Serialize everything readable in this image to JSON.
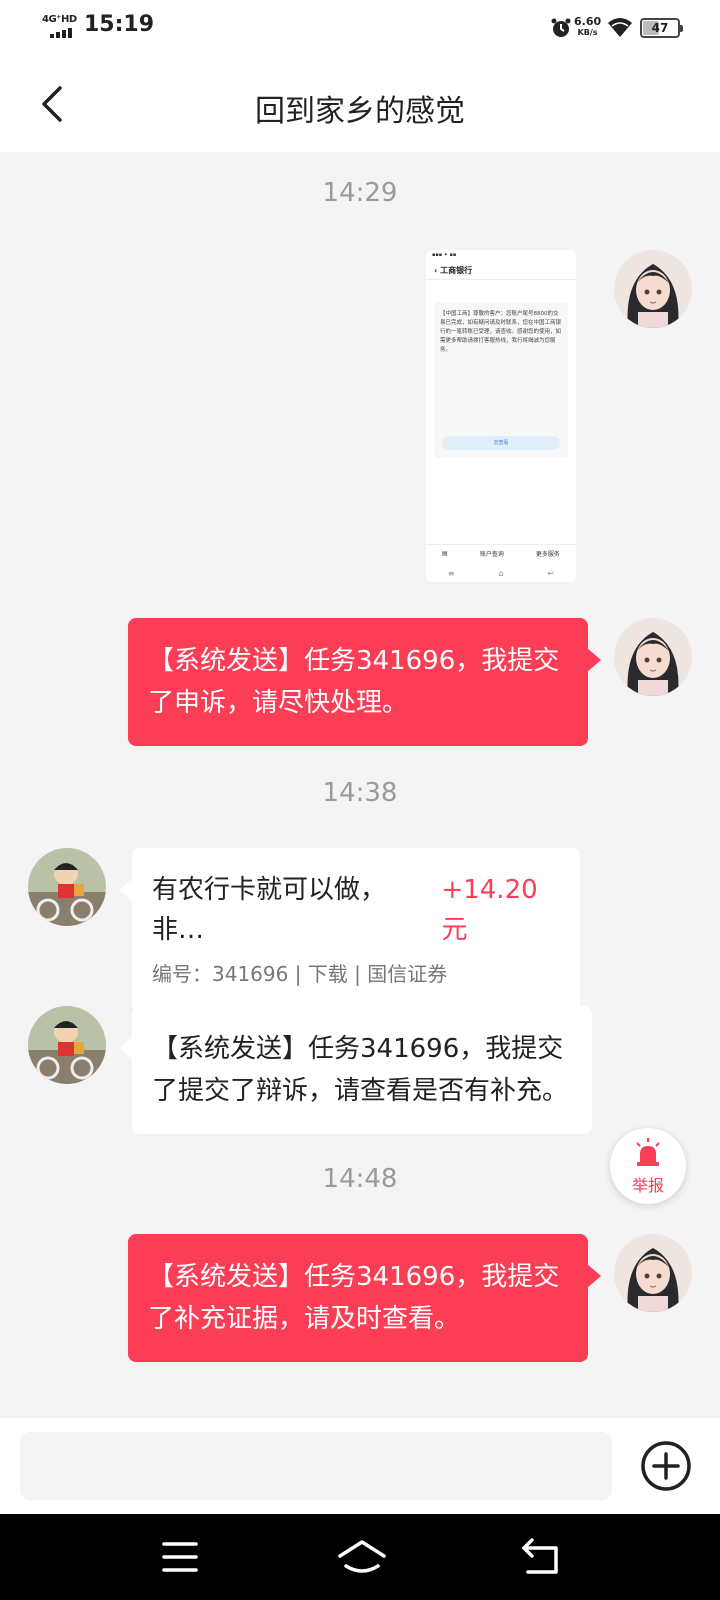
{
  "status_bar": {
    "network": "4G⁺HD",
    "time": "15:19",
    "speed_value": "6.60",
    "speed_unit": "KB/s",
    "battery": "47"
  },
  "header": {
    "title": "回到家乡的感觉",
    "back_icon": "chevron-left-icon"
  },
  "messages": {
    "ts1": "14:29",
    "ts2": "14:38",
    "ts3": "14:48",
    "screenshot": {
      "app_title": "工商银行",
      "card_text": "【中国工商】尊敬的客户：您账户尾号8800的交易已完成，如有疑问请及时联系，您在中国工商银行的一笔转账已受理，请查收。感谢您的使用，如需更多帮助请拨打客服热线，我行将竭诚为您服务。",
      "card_button": "去查看",
      "footer_left": "账户查询",
      "footer_right": "更多服务"
    },
    "red1": "【系统发送】任务341696，我提交了申诉，请尽快处理。",
    "task_card": {
      "title": "有农行卡就可以做，非…",
      "amount": "+14.20元",
      "meta": "编号：341696 | 下载 | 国信证券"
    },
    "white2": "【系统发送】任务341696，我提交了提交了辩诉，请查看是否有补充。",
    "red2": "【系统发送】任务341696，我提交了补充证据，请及时查看。"
  },
  "report_button": {
    "label": "举报",
    "icon": "alarm-siren-icon"
  },
  "input_bar": {
    "placeholder": "",
    "add_icon": "plus-circle-icon"
  },
  "nav": {
    "menu_icon": "menu-icon",
    "home_icon": "home-icon",
    "back_icon": "back-arrow-icon"
  },
  "colors": {
    "accent": "#fb3d55",
    "background": "#f4f4f4",
    "bubble_white": "#ffffff",
    "timestamp": "#9a9a9a"
  }
}
